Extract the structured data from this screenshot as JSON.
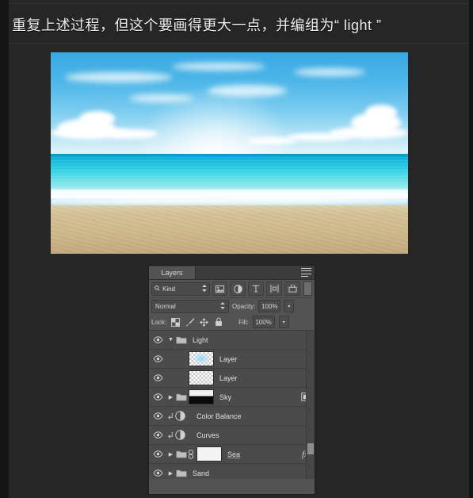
{
  "caption": {
    "text": "重复上述过程，但这个要画得更大一点，并编组为“ light ”"
  },
  "photo": {
    "alt_name": "beach-sea-sky-photo"
  },
  "panel": {
    "tab_label": "Layers",
    "menu_icon": "panel-menu-icon",
    "filter": {
      "kind_label": "Kind",
      "search_icon": "search-icon",
      "stepper_icon": "updown-arrows-icon",
      "buttons": [
        {
          "name": "filter-pixel-layers",
          "glyph": "▣"
        },
        {
          "name": "filter-adjustment-layers",
          "glyph": "◑"
        },
        {
          "name": "filter-type-layers",
          "glyph": "T"
        },
        {
          "name": "filter-shape-layers",
          "glyph": "⌗"
        },
        {
          "name": "filter-smart-object-layers",
          "glyph": "⬕"
        }
      ],
      "toggle_name": "filter-enable-toggle"
    },
    "blend": {
      "mode": "Normal",
      "opacity_label": "Opacity:",
      "opacity_value": "100%",
      "stepper": "▾"
    },
    "lock": {
      "label": "Lock:",
      "icons": [
        {
          "name": "lock-transparent-pixels-icon",
          "glyph": "▩"
        },
        {
          "name": "lock-image-pixels-icon",
          "glyph": "🖌"
        },
        {
          "name": "lock-position-icon",
          "glyph": "✛"
        },
        {
          "name": "lock-all-icon",
          "glyph": "🔒"
        }
      ],
      "fill_label": "Fill:",
      "fill_value": "100%",
      "stepper": "▾"
    },
    "layers": [
      {
        "name": "Light",
        "type": "group",
        "expanded": true,
        "chevron": "▼",
        "visible": true,
        "has_folder": true,
        "thumb": "none",
        "right_icon": "",
        "indent": 0
      },
      {
        "name": "Layer",
        "type": "pixel",
        "visible": true,
        "thumb": "checker-glow",
        "right_icon": "",
        "indent": 1
      },
      {
        "name": "Layer",
        "type": "pixel",
        "visible": true,
        "thumb": "checker",
        "right_icon": "",
        "indent": 1
      },
      {
        "name": "Sky",
        "type": "group",
        "expanded": false,
        "chevron": "▶",
        "visible": true,
        "has_folder": true,
        "thumb": "mask-half",
        "right_icon": "layer-mask-icon",
        "indent": 0
      },
      {
        "name": "Color Balance",
        "type": "adjustment",
        "visible": true,
        "clipped": true,
        "thumb": "none",
        "right_icon": "",
        "indent": 1
      },
      {
        "name": "Curves",
        "type": "adjustment",
        "visible": true,
        "clipped": true,
        "thumb": "none",
        "right_icon": "",
        "indent": 1
      },
      {
        "name": "Sea",
        "type": "group",
        "expanded": false,
        "chevron": "▶",
        "visible": true,
        "has_folder": true,
        "linked": true,
        "thumb": "mask-white",
        "right_icon": "fx",
        "indent": 0
      },
      {
        "name": "Sand",
        "type": "group",
        "expanded": false,
        "chevron": "▶",
        "visible": true,
        "has_folder": true,
        "thumb": "none",
        "right_icon": "",
        "indent": 0
      }
    ],
    "scrollbar": {
      "name": "layers-scrollbar"
    }
  },
  "colors": {
    "page_bg": "#262626",
    "panel_bg": "#535353",
    "list_bg": "#4b4b4b",
    "text": "#e0e0e0",
    "sky": "#4cb6e8",
    "sea": "#35d3e6",
    "sand": "#cfba8d"
  }
}
